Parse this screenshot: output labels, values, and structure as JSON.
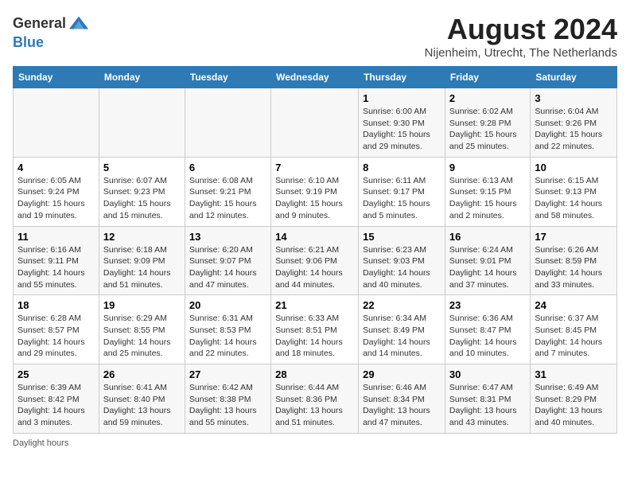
{
  "logo": {
    "general": "General",
    "blue": "Blue"
  },
  "title": "August 2024",
  "subtitle": "Nijenheim, Utrecht, The Netherlands",
  "days_of_week": [
    "Sunday",
    "Monday",
    "Tuesday",
    "Wednesday",
    "Thursday",
    "Friday",
    "Saturday"
  ],
  "weeks": [
    [
      {
        "day": "",
        "detail": ""
      },
      {
        "day": "",
        "detail": ""
      },
      {
        "day": "",
        "detail": ""
      },
      {
        "day": "",
        "detail": ""
      },
      {
        "day": "1",
        "detail": "Sunrise: 6:00 AM\nSunset: 9:30 PM\nDaylight: 15 hours and 29 minutes."
      },
      {
        "day": "2",
        "detail": "Sunrise: 6:02 AM\nSunset: 9:28 PM\nDaylight: 15 hours and 25 minutes."
      },
      {
        "day": "3",
        "detail": "Sunrise: 6:04 AM\nSunset: 9:26 PM\nDaylight: 15 hours and 22 minutes."
      }
    ],
    [
      {
        "day": "4",
        "detail": "Sunrise: 6:05 AM\nSunset: 9:24 PM\nDaylight: 15 hours and 19 minutes."
      },
      {
        "day": "5",
        "detail": "Sunrise: 6:07 AM\nSunset: 9:23 PM\nDaylight: 15 hours and 15 minutes."
      },
      {
        "day": "6",
        "detail": "Sunrise: 6:08 AM\nSunset: 9:21 PM\nDaylight: 15 hours and 12 minutes."
      },
      {
        "day": "7",
        "detail": "Sunrise: 6:10 AM\nSunset: 9:19 PM\nDaylight: 15 hours and 9 minutes."
      },
      {
        "day": "8",
        "detail": "Sunrise: 6:11 AM\nSunset: 9:17 PM\nDaylight: 15 hours and 5 minutes."
      },
      {
        "day": "9",
        "detail": "Sunrise: 6:13 AM\nSunset: 9:15 PM\nDaylight: 15 hours and 2 minutes."
      },
      {
        "day": "10",
        "detail": "Sunrise: 6:15 AM\nSunset: 9:13 PM\nDaylight: 14 hours and 58 minutes."
      }
    ],
    [
      {
        "day": "11",
        "detail": "Sunrise: 6:16 AM\nSunset: 9:11 PM\nDaylight: 14 hours and 55 minutes."
      },
      {
        "day": "12",
        "detail": "Sunrise: 6:18 AM\nSunset: 9:09 PM\nDaylight: 14 hours and 51 minutes."
      },
      {
        "day": "13",
        "detail": "Sunrise: 6:20 AM\nSunset: 9:07 PM\nDaylight: 14 hours and 47 minutes."
      },
      {
        "day": "14",
        "detail": "Sunrise: 6:21 AM\nSunset: 9:06 PM\nDaylight: 14 hours and 44 minutes."
      },
      {
        "day": "15",
        "detail": "Sunrise: 6:23 AM\nSunset: 9:03 PM\nDaylight: 14 hours and 40 minutes."
      },
      {
        "day": "16",
        "detail": "Sunrise: 6:24 AM\nSunset: 9:01 PM\nDaylight: 14 hours and 37 minutes."
      },
      {
        "day": "17",
        "detail": "Sunrise: 6:26 AM\nSunset: 8:59 PM\nDaylight: 14 hours and 33 minutes."
      }
    ],
    [
      {
        "day": "18",
        "detail": "Sunrise: 6:28 AM\nSunset: 8:57 PM\nDaylight: 14 hours and 29 minutes."
      },
      {
        "day": "19",
        "detail": "Sunrise: 6:29 AM\nSunset: 8:55 PM\nDaylight: 14 hours and 25 minutes."
      },
      {
        "day": "20",
        "detail": "Sunrise: 6:31 AM\nSunset: 8:53 PM\nDaylight: 14 hours and 22 minutes."
      },
      {
        "day": "21",
        "detail": "Sunrise: 6:33 AM\nSunset: 8:51 PM\nDaylight: 14 hours and 18 minutes."
      },
      {
        "day": "22",
        "detail": "Sunrise: 6:34 AM\nSunset: 8:49 PM\nDaylight: 14 hours and 14 minutes."
      },
      {
        "day": "23",
        "detail": "Sunrise: 6:36 AM\nSunset: 8:47 PM\nDaylight: 14 hours and 10 minutes."
      },
      {
        "day": "24",
        "detail": "Sunrise: 6:37 AM\nSunset: 8:45 PM\nDaylight: 14 hours and 7 minutes."
      }
    ],
    [
      {
        "day": "25",
        "detail": "Sunrise: 6:39 AM\nSunset: 8:42 PM\nDaylight: 14 hours and 3 minutes."
      },
      {
        "day": "26",
        "detail": "Sunrise: 6:41 AM\nSunset: 8:40 PM\nDaylight: 13 hours and 59 minutes."
      },
      {
        "day": "27",
        "detail": "Sunrise: 6:42 AM\nSunset: 8:38 PM\nDaylight: 13 hours and 55 minutes."
      },
      {
        "day": "28",
        "detail": "Sunrise: 6:44 AM\nSunset: 8:36 PM\nDaylight: 13 hours and 51 minutes."
      },
      {
        "day": "29",
        "detail": "Sunrise: 6:46 AM\nSunset: 8:34 PM\nDaylight: 13 hours and 47 minutes."
      },
      {
        "day": "30",
        "detail": "Sunrise: 6:47 AM\nSunset: 8:31 PM\nDaylight: 13 hours and 43 minutes."
      },
      {
        "day": "31",
        "detail": "Sunrise: 6:49 AM\nSunset: 8:29 PM\nDaylight: 13 hours and 40 minutes."
      }
    ]
  ],
  "footer": "Daylight hours"
}
